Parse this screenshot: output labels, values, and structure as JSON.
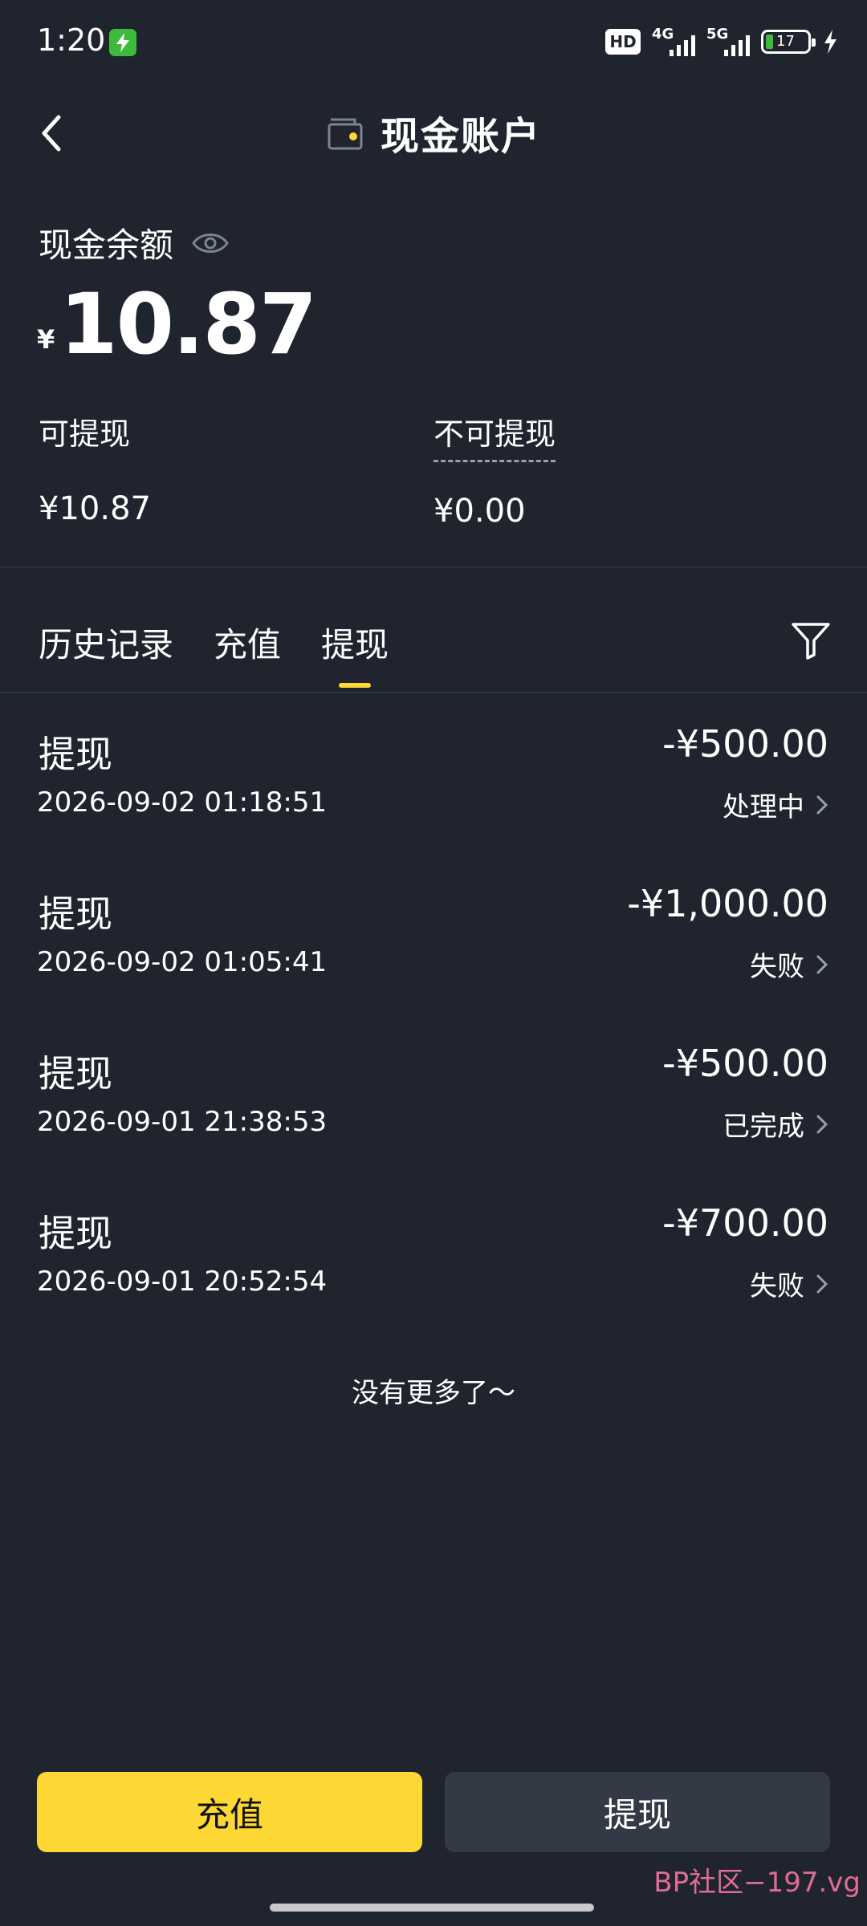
{
  "status_bar": {
    "time": "1:20",
    "hd_label": "HD",
    "signal1": "4G",
    "signal2": "5G",
    "battery": "17"
  },
  "header": {
    "title": "现金账户",
    "icons": [
      "back-icon",
      "wallet-icon"
    ]
  },
  "balance": {
    "label": "现金余额",
    "currency": "¥",
    "amount": "10.87",
    "withdrawable_label": "可提现",
    "withdrawable_value": "¥10.87",
    "non_withdrawable_label": "不可提现",
    "non_withdrawable_value": "¥0.00"
  },
  "tabs": {
    "items": [
      {
        "label": "历史记录",
        "active": false
      },
      {
        "label": "充值",
        "active": false
      },
      {
        "label": "提现",
        "active": true
      }
    ],
    "filter_icon": "filter-icon"
  },
  "records": [
    {
      "type": "提现",
      "amount": "-¥500.00",
      "time": "2026-09-02 01:18:51",
      "status": "处理中"
    },
    {
      "type": "提现",
      "amount": "-¥1,000.00",
      "time": "2026-09-02 01:05:41",
      "status": "失败"
    },
    {
      "type": "提现",
      "amount": "-¥500.00",
      "time": "2026-09-01 21:38:53",
      "status": "已完成"
    },
    {
      "type": "提现",
      "amount": "-¥700.00",
      "time": "2026-09-01 20:52:54",
      "status": "失败"
    }
  ],
  "no_more_text": "没有更多了～",
  "buttons": {
    "recharge": "充值",
    "withdraw": "提现"
  },
  "watermark": "BP社区−197.vg",
  "colors": {
    "background": "#1f242e",
    "accent": "#fdd835",
    "secondary_button": "#343a45",
    "watermark": "#e06c96"
  }
}
